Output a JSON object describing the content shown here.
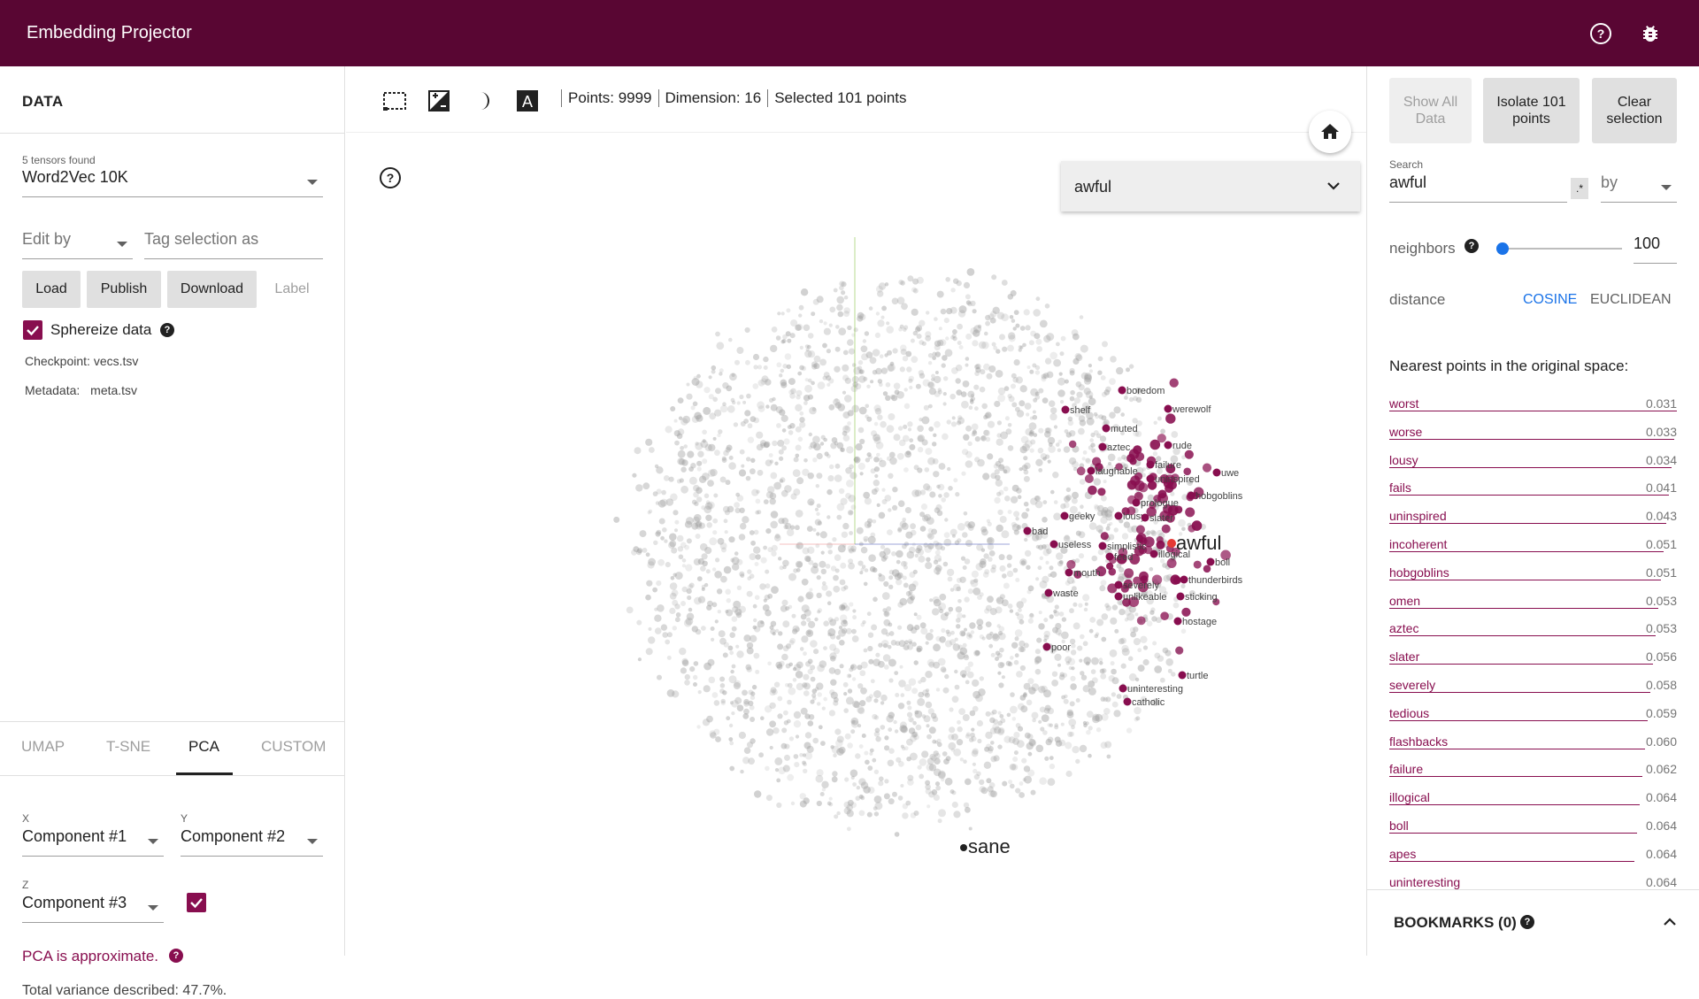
{
  "app": {
    "title": "Embedding Projector"
  },
  "topbar": {
    "help_icon": "help-circle-icon",
    "bug_icon": "bug-icon"
  },
  "left": {
    "section_title": "DATA",
    "tensors_found": "5 tensors found",
    "tensor_selected": "Word2Vec 10K",
    "edit_by_placeholder": "Edit by",
    "tag_selection_placeholder": "Tag selection as",
    "buttons": {
      "load": "Load",
      "publish": "Publish",
      "download": "Download",
      "label": "Label"
    },
    "sphereize_label": "Sphereize data",
    "sphereize_checked": true,
    "checkpoint_label": "Checkpoint:",
    "checkpoint_value": "vecs.tsv",
    "metadata_label": "Metadata:",
    "metadata_value": "meta.tsv",
    "tabs": [
      "UMAP",
      "T-SNE",
      "PCA",
      "CUSTOM"
    ],
    "active_tab": "PCA",
    "pca": {
      "x_label": "X",
      "x_value": "Component #1",
      "y_label": "Y",
      "y_value": "Component #2",
      "z_label": "Z",
      "z_value": "Component #3",
      "z_enabled": true,
      "approximate_text": "PCA is approximate.",
      "variance_text": "Total variance described: 47.7%."
    }
  },
  "toolbar": {
    "points": "Points: 9999",
    "dimension": "Dimension: 16",
    "selected": "Selected 101 points"
  },
  "view": {
    "search_value": "awful",
    "selected_word": "awful",
    "far_word": "sane",
    "labels": [
      "boredom",
      "shelf",
      "werewolf",
      "muted",
      "aztec",
      "rude",
      "failure",
      "laughable",
      "uninspired",
      "uwe",
      "hobgoblins",
      "prologue",
      "geeky",
      "lousy",
      "slater",
      "bad",
      "useless",
      "simplistic",
      "feed",
      "illogical",
      "boll",
      "mouth",
      "severely",
      "thunderbirds",
      "waste",
      "unlikeable",
      "sticking",
      "hostage",
      "poor",
      "turtle",
      "uninteresting",
      "catholic"
    ],
    "accent": "#880e4f"
  },
  "right": {
    "show_all": "Show All Data",
    "isolate": "Isolate 101 points",
    "clear": "Clear selection",
    "search_label": "Search",
    "search_value": "awful",
    "regex_symbol": ".*",
    "by_label": "by",
    "neighbors_label": "neighbors",
    "neighbors_value": "100",
    "neighbors_fraction": 0.05,
    "distance_label": "distance",
    "cosine": "COSINE",
    "euclidean": "EUCLIDEAN",
    "nearest_title": "Nearest points in the original space:",
    "nearest": [
      {
        "word": "worst",
        "dist": "0.031"
      },
      {
        "word": "worse",
        "dist": "0.033"
      },
      {
        "word": "lousy",
        "dist": "0.034"
      },
      {
        "word": "fails",
        "dist": "0.041"
      },
      {
        "word": "uninspired",
        "dist": "0.043"
      },
      {
        "word": "incoherent",
        "dist": "0.051"
      },
      {
        "word": "hobgoblins",
        "dist": "0.051"
      },
      {
        "word": "omen",
        "dist": "0.053"
      },
      {
        "word": "aztec",
        "dist": "0.053"
      },
      {
        "word": "slater",
        "dist": "0.056"
      },
      {
        "word": "severely",
        "dist": "0.058"
      },
      {
        "word": "tedious",
        "dist": "0.059"
      },
      {
        "word": "flashbacks",
        "dist": "0.060"
      },
      {
        "word": "failure",
        "dist": "0.062"
      },
      {
        "word": "illogical",
        "dist": "0.064"
      },
      {
        "word": "boll",
        "dist": "0.064"
      },
      {
        "word": "apes",
        "dist": "0.064"
      },
      {
        "word": "uninteresting",
        "dist": "0.064"
      }
    ],
    "bookmarks": "BOOKMARKS (0)"
  }
}
